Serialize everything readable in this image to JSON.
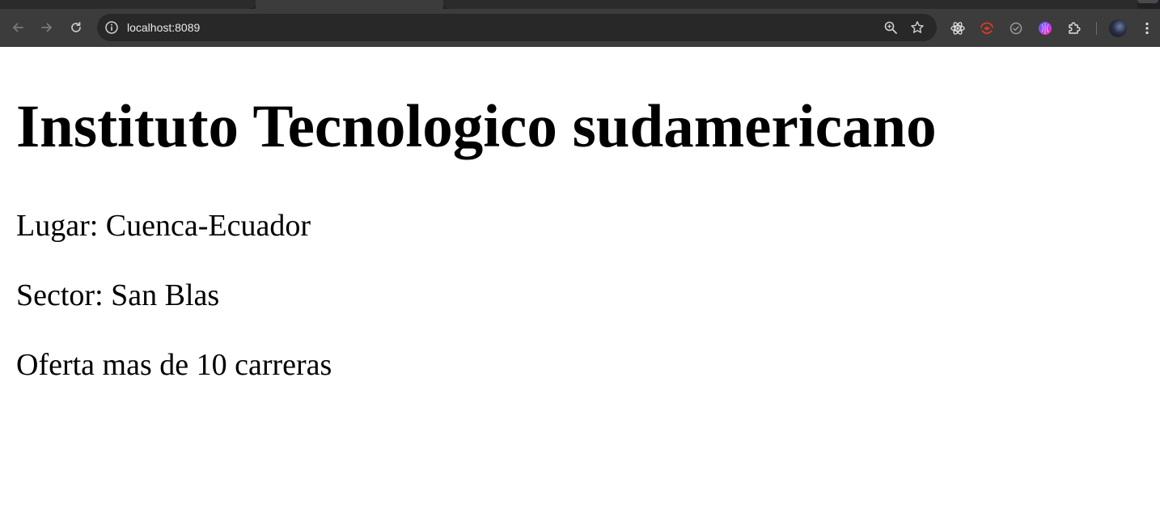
{
  "browser": {
    "address_bar": {
      "url": "localhost:8089"
    },
    "icons": {
      "back": "back-arrow-icon",
      "forward": "forward-arrow-icon",
      "reload": "reload-icon",
      "site_info": "info-icon",
      "zoom": "zoom-icon",
      "bookmark": "star-icon",
      "extensions": [
        "react-devtools-icon",
        "red-extension-icon",
        "circle-extension-icon",
        "color-extension-icon",
        "puzzle-icon"
      ],
      "menu": "kebab-menu-icon"
    },
    "colors": {
      "chrome_bg": "#3c3c3c",
      "omnibox_bg": "#282828",
      "url_text": "#e8eaed"
    }
  },
  "page": {
    "heading": "Instituto Tecnologico sudamericano",
    "lines": [
      "Lugar: Cuenca-Ecuador",
      "Sector: San Blas",
      "Oferta mas de 10 carreras"
    ]
  }
}
